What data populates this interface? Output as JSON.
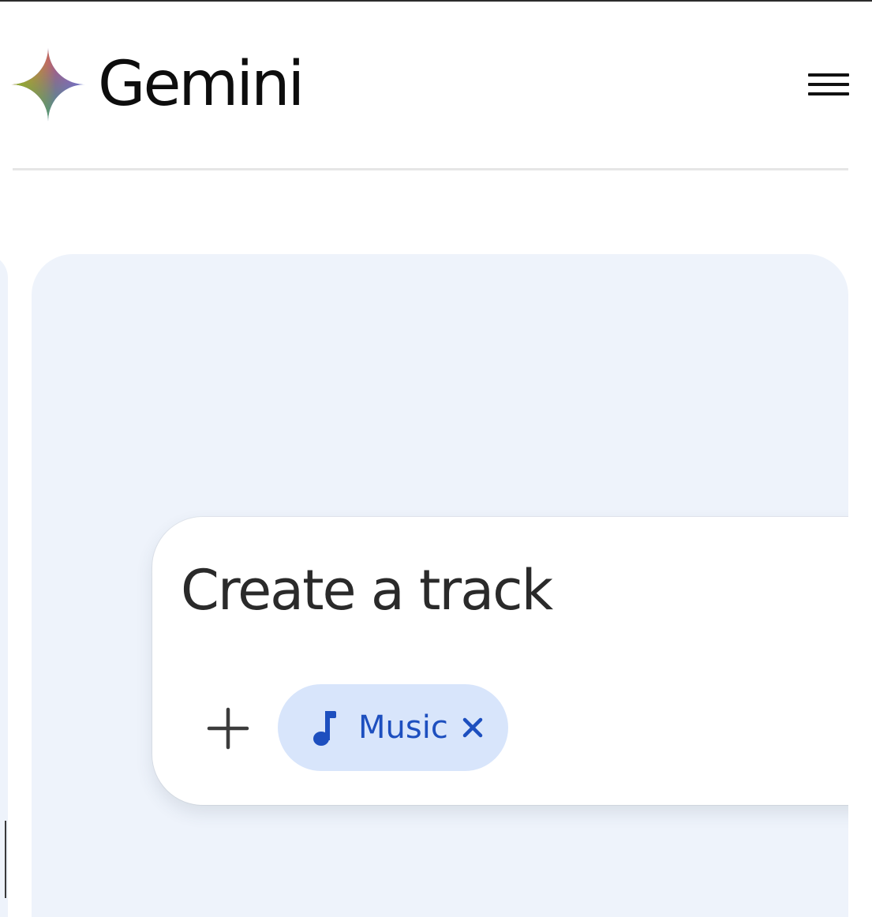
{
  "header": {
    "app_name": "Gemini",
    "logo_icon": "gemini-sparkle-icon",
    "menu_icon": "hamburger-menu-icon"
  },
  "prompt": {
    "text": "Create a track",
    "add_icon": "plus-icon",
    "chip": {
      "label": "Music",
      "icon": "music-note-icon",
      "close_icon": "close-icon"
    }
  },
  "colors": {
    "stage_background": "#eef3fb",
    "chip_background": "#d8e5fb",
    "chip_text": "#1d4fbf",
    "brand_blue": "#4285f4",
    "brand_red": "#ea4335",
    "brand_yellow": "#fbbc04",
    "brand_green": "#34a853"
  }
}
